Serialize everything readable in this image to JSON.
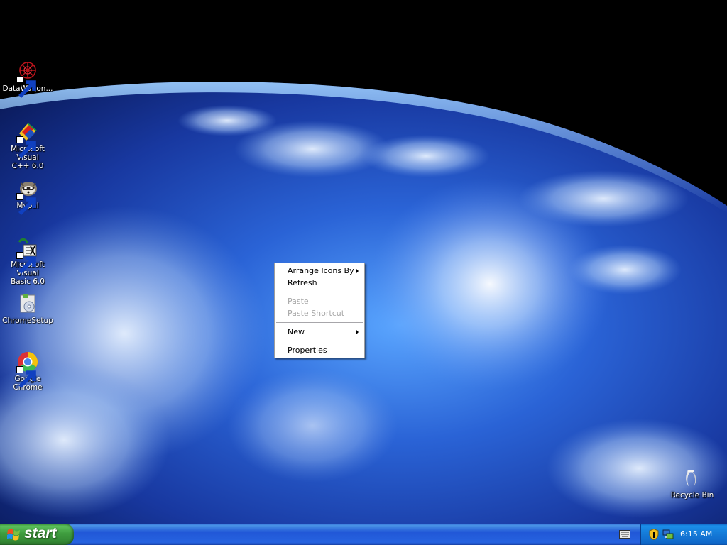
{
  "desktop": {
    "icons": [
      {
        "label": "DataWagon...",
        "icon": "datawagon-icon",
        "shortcut": true
      },
      {
        "label": "Microsoft Visual\nC++ 6.0",
        "icon": "visual-cpp-icon",
        "shortcut": true
      },
      {
        "label": "Mypal",
        "icon": "mypal-icon",
        "shortcut": true
      },
      {
        "label": "Microsoft Visual\nBasic 6.0",
        "icon": "visual-basic-icon",
        "shortcut": true
      },
      {
        "label": "ChromeSetup",
        "icon": "installer-icon",
        "shortcut": false
      },
      {
        "label": "Google Chrome",
        "icon": "chrome-icon",
        "shortcut": true
      }
    ],
    "recycle_bin": {
      "label": "Recycle Bin",
      "icon": "recycle-bin-icon"
    }
  },
  "context_menu": {
    "arrange_icons_by": "Arrange Icons By",
    "refresh": "Refresh",
    "paste": "Paste",
    "paste_shortcut": "Paste Shortcut",
    "new": "New",
    "properties": "Properties"
  },
  "taskbar": {
    "start_label": "start",
    "clock": "6:15 AM"
  },
  "colors": {
    "taskbar_blue": "#245edb",
    "start_green": "#3c9a3c",
    "tray_blue": "#1479d7",
    "menu_disabled": "#a7a7a7"
  }
}
